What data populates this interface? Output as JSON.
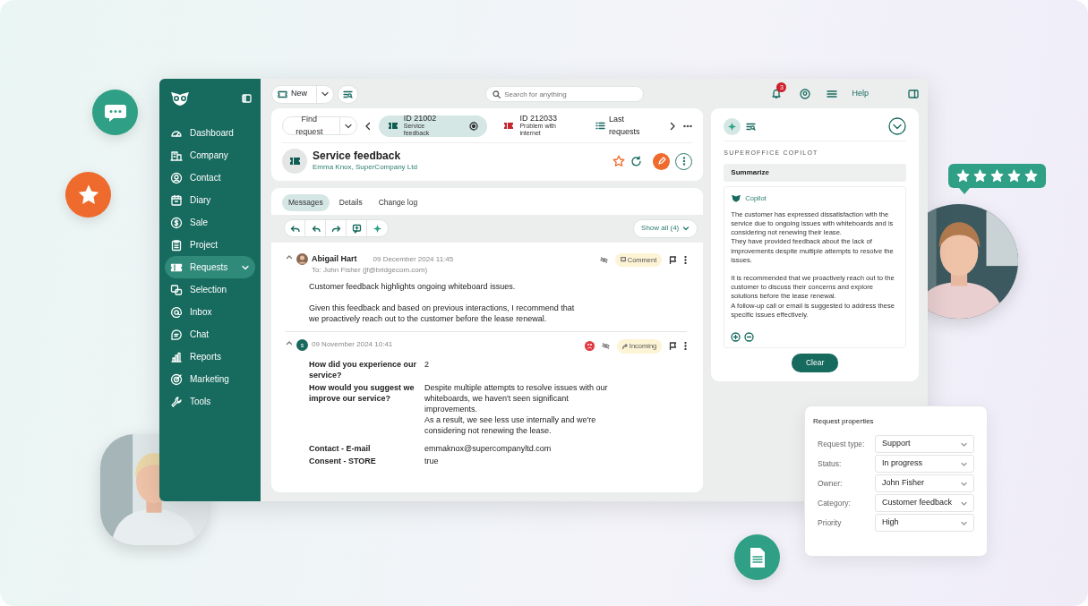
{
  "window_toolbar": {
    "new_button": "New",
    "search_placeholder": "Search for anything",
    "notification_count": "3",
    "help_link": "Help"
  },
  "sidebar": {
    "items": [
      {
        "label": "Dashboard",
        "selected": false,
        "submenu": false
      },
      {
        "label": "Company",
        "selected": false,
        "submenu": false
      },
      {
        "label": "Contact",
        "selected": false,
        "submenu": false
      },
      {
        "label": "Diary",
        "selected": false,
        "submenu": false
      },
      {
        "label": "Sale",
        "selected": false,
        "submenu": false
      },
      {
        "label": "Project",
        "selected": false,
        "submenu": false
      },
      {
        "label": "Requests",
        "selected": true,
        "submenu": true
      },
      {
        "label": "Selection",
        "selected": false,
        "submenu": false
      },
      {
        "label": "Inbox",
        "selected": false,
        "submenu": false
      },
      {
        "label": "Chat",
        "selected": false,
        "submenu": false
      },
      {
        "label": "Reports",
        "selected": false,
        "submenu": false
      },
      {
        "label": "Marketing",
        "selected": false,
        "submenu": false
      },
      {
        "label": "Tools",
        "selected": false,
        "submenu": false
      }
    ]
  },
  "request_bar": {
    "find_button": "Find request",
    "tabs": [
      {
        "id": "ID 21002",
        "subtitle": "Service feedback",
        "selected": true,
        "color": "#0f5c52"
      },
      {
        "id": "ID 212033",
        "subtitle": "Problem with internet",
        "selected": false,
        "color": "#c4262e"
      }
    ],
    "last_requests": "Last requests"
  },
  "request": {
    "title": "Service feedback",
    "contact": "Emma Knox, SuperCompany Ltd"
  },
  "message_tabs": [
    {
      "label": "Messages",
      "selected": true
    },
    {
      "label": "Details",
      "selected": false
    },
    {
      "label": "Change log",
      "selected": false
    }
  ],
  "show_all": "Show all (4)",
  "messages": [
    {
      "kind": "email",
      "author": "Abigail Hart",
      "date": "09 December 2024 11:45",
      "recipient": "To: John Fisher (jf@bridgecom.com)",
      "tag": {
        "kind": "comment",
        "label": "Comment"
      },
      "negative_sentiment": false,
      "body": [
        "Customer feedback highlights ongoing whiteboard issues.",
        "Given this feedback and based on previous interactions, I recommend that we proactively reach out to the customer before the lease renewal."
      ]
    },
    {
      "kind": "survey",
      "avatar_letter": "s",
      "date": "09 November 2024 10:41",
      "tag": {
        "kind": "incoming",
        "label": "Incoming"
      },
      "negative_sentiment": true,
      "fields": [
        {
          "label": "How did you experience our service?",
          "value": [
            "2"
          ]
        },
        {
          "label": "How would you suggest we improve our service?",
          "value": [
            "Despite multiple attempts to resolve issues with our whiteboards, we haven't seen significant improvements.",
            "As a result, we see less use internally and we're considering not renewing the lease."
          ]
        },
        {
          "label": "Contact - E-mail",
          "value": [
            "emmaknox@supercompanyltd.com"
          ]
        },
        {
          "label": "Consent - STORE",
          "value": [
            "true"
          ]
        }
      ]
    }
  ],
  "copilot": {
    "heading": "SUPEROFFICE COPILOT",
    "prompt": "Summarize",
    "author": "Copilot",
    "answer": [
      [
        "The customer has expressed dissatisfaction with the service due to ongoing issues with whiteboards and is considering not renewing their lease.",
        "They have provided feedback about the lack of improvements despite multiple attempts to resolve the issues."
      ],
      [
        "It is recommended that we proactively reach out to the customer to discuss their concerns and explore solutions before the lease renewal.",
        "A follow-up call or email is suggested to address these specific issues effectively."
      ]
    ],
    "clear_button": "Clear"
  },
  "request_properties": {
    "title": "Request properties",
    "fields": [
      {
        "label": "Request type:",
        "value": "Support"
      },
      {
        "label": "Status:",
        "value": "In progress"
      },
      {
        "label": "Owner:",
        "value": "John Fisher"
      },
      {
        "label": "Category:",
        "value": "Customer feedback"
      },
      {
        "label": "Priority",
        "value": "High"
      }
    ]
  },
  "rating_badge": {
    "stars": 5
  }
}
